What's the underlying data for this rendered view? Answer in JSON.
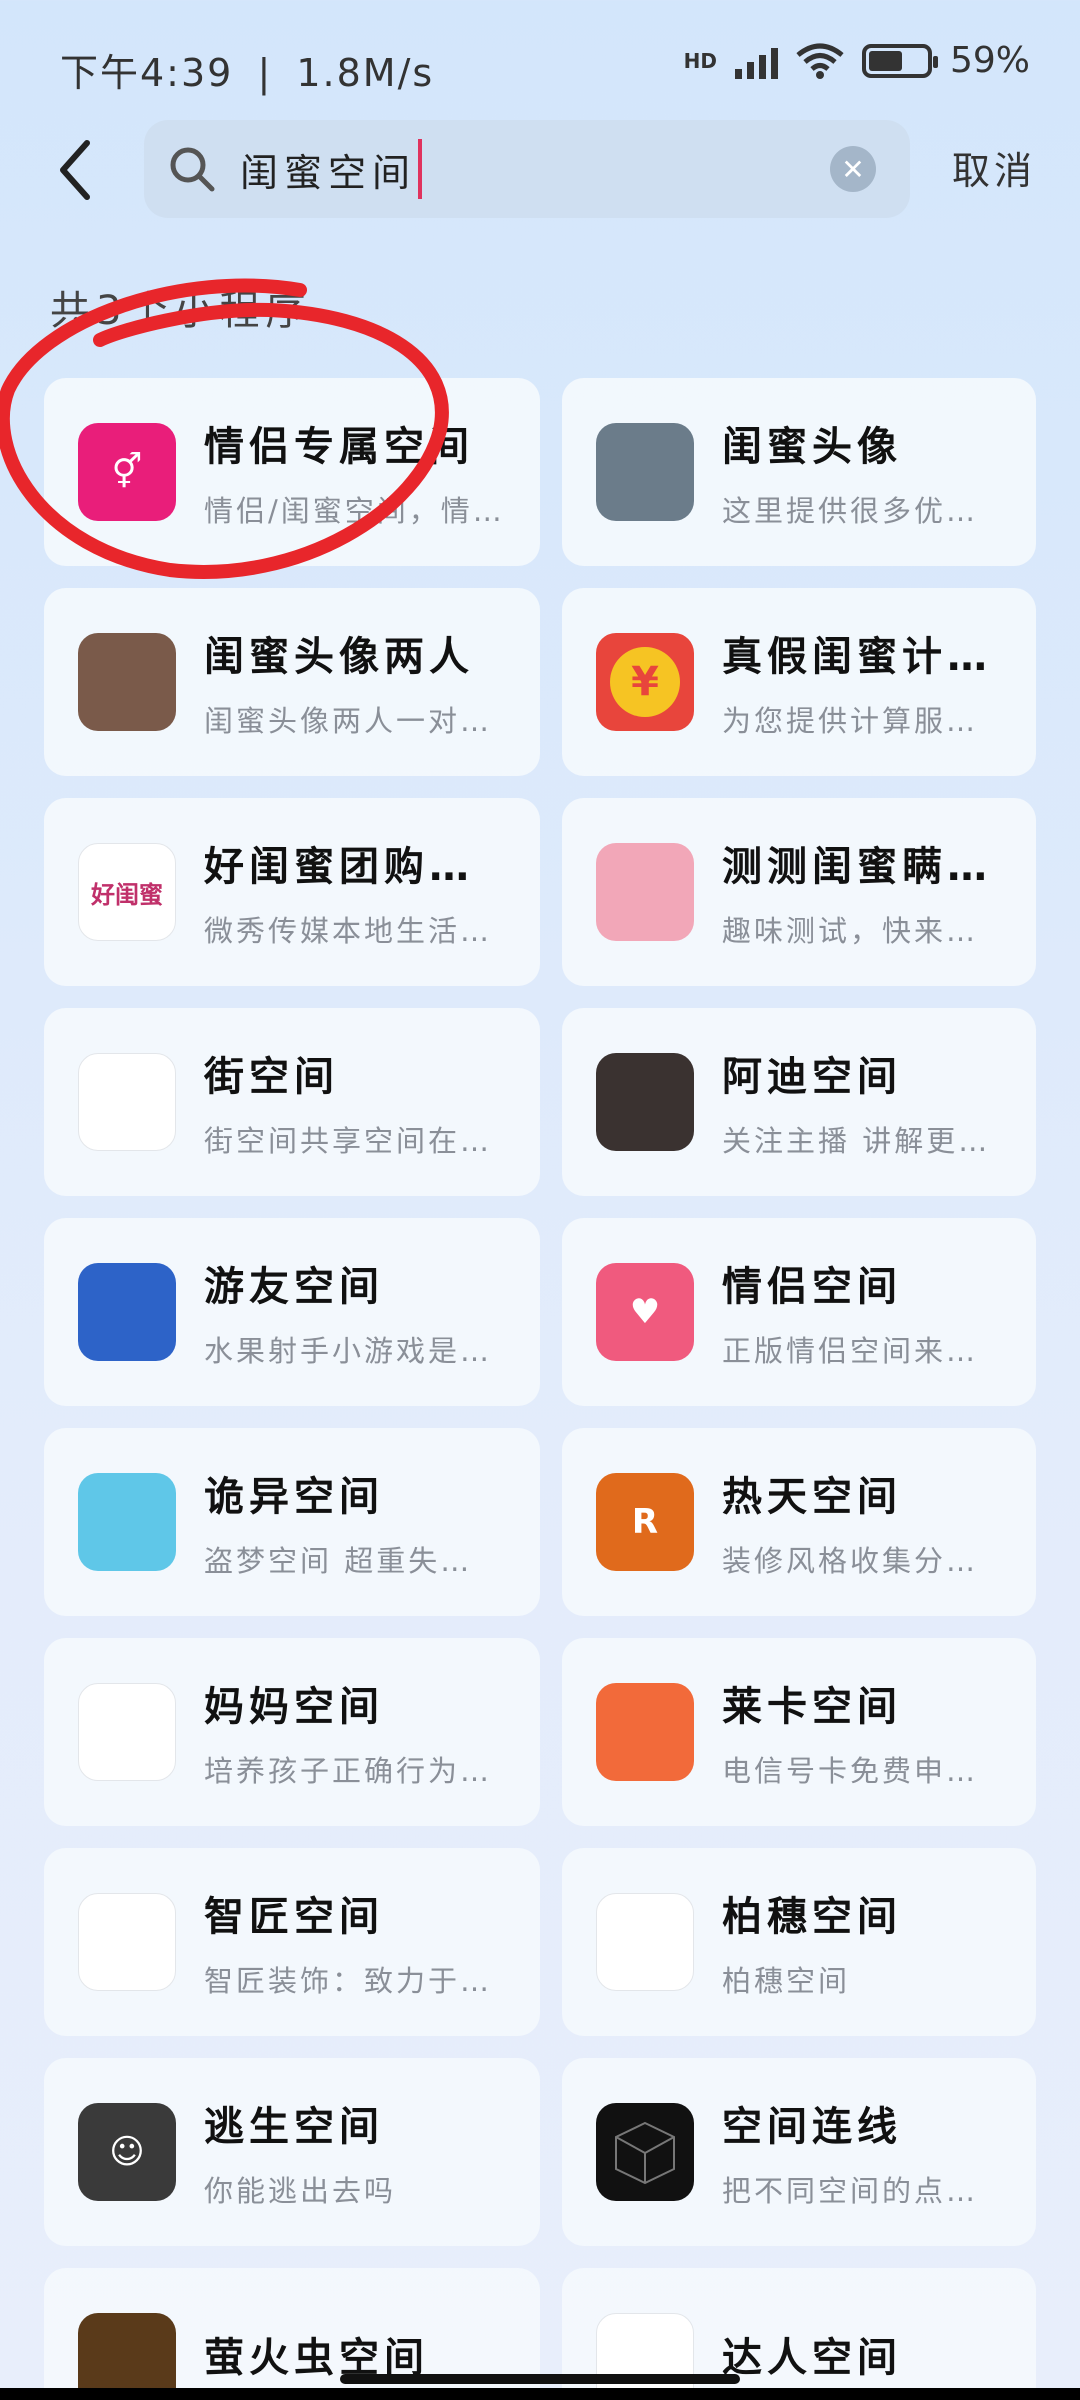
{
  "status_bar": {
    "time": "下午4:39",
    "speed": "1.8M/s",
    "network": "HD",
    "battery_text": "59",
    "battery_level": 0.59
  },
  "search": {
    "query": "闺蜜空间",
    "cancel_label": "取消"
  },
  "result_count_label": "共3个小程序",
  "apps": [
    {
      "name": "情侣专属空间",
      "desc": "情侣/闺蜜空间，情…",
      "icon": "couple-symbol-icon",
      "color": "#e91e7a"
    },
    {
      "name": "闺蜜头像",
      "desc": "这里提供很多优…",
      "icon": "two-girls-photo-icon",
      "color": "#6b7c8a"
    },
    {
      "name": "闺蜜头像两人",
      "desc": "闺蜜头像两人一对…",
      "icon": "girl-portrait-icon",
      "color": "#7a5a4a"
    },
    {
      "name": "真假闺蜜计算器",
      "desc": "为您提供计算服…",
      "icon": "yen-coin-icon",
      "color": "#e8453c"
    },
    {
      "name": "好闺蜜团购优选",
      "desc": "微秀传媒本地生活…",
      "icon": "hao-gui-mi-logo-icon",
      "color": "#ffffff",
      "icon_text": "好闺蜜"
    },
    {
      "name": "测测闺蜜瞒着…",
      "desc": "趣味测试，快来…",
      "icon": "anime-girl-icon",
      "color": "#f2a7b8"
    },
    {
      "name": "街空间",
      "desc": "街空间共享空间在…",
      "icon": "street-space-logo-icon",
      "color": "#ffffff"
    },
    {
      "name": "阿迪空间",
      "desc": "关注主播 讲解更…",
      "icon": "photo-thumbnail-icon",
      "color": "#3a3230"
    },
    {
      "name": "游友空间",
      "desc": "水果射手小游戏是…",
      "icon": "fruit-game-icon",
      "color": "#2d63c8"
    },
    {
      "name": "情侣空间",
      "desc": "正版情侣空间来…",
      "icon": "hearts-icon",
      "color": "#f05a7e"
    },
    {
      "name": "诡异空间",
      "desc": "盗梦空间 超重失…",
      "icon": "floating-island-icon",
      "color": "#5fc7e8"
    },
    {
      "name": "热天空间",
      "desc": "装修风格收集分…",
      "icon": "orange-r-logo-icon",
      "color": "#e06a1c"
    },
    {
      "name": "妈妈空间",
      "desc": "培养孩子正确行为…",
      "icon": "mama-space-logo-icon",
      "color": "#ffffff"
    },
    {
      "name": "莱卡空间",
      "desc": "电信号卡免费申…",
      "icon": "orange-signal-icon",
      "color": "#f26a3a"
    },
    {
      "name": "智匠空间",
      "desc": "智匠装饰：致力于…",
      "icon": "zhijiang-logo-icon",
      "color": "#ffffff"
    },
    {
      "name": "柏穗空间",
      "desc": "柏穗空间",
      "icon": "baisui-logo-icon",
      "color": "#ffffff"
    },
    {
      "name": "逃生空间",
      "desc": "你能逃出去吗",
      "icon": "smiley-face-icon",
      "color": "#3a3a3a"
    },
    {
      "name": "空间连线",
      "desc": "把不同空间的点…",
      "icon": "black-cube-icon",
      "color": "#111111"
    },
    {
      "name": "萤火虫空间",
      "desc": "",
      "icon": "firefly-icon",
      "color": "#5a3a1a"
    },
    {
      "name": "达人空间",
      "desc": "",
      "icon": "house-logo-icon",
      "color": "#ffffff"
    }
  ]
}
